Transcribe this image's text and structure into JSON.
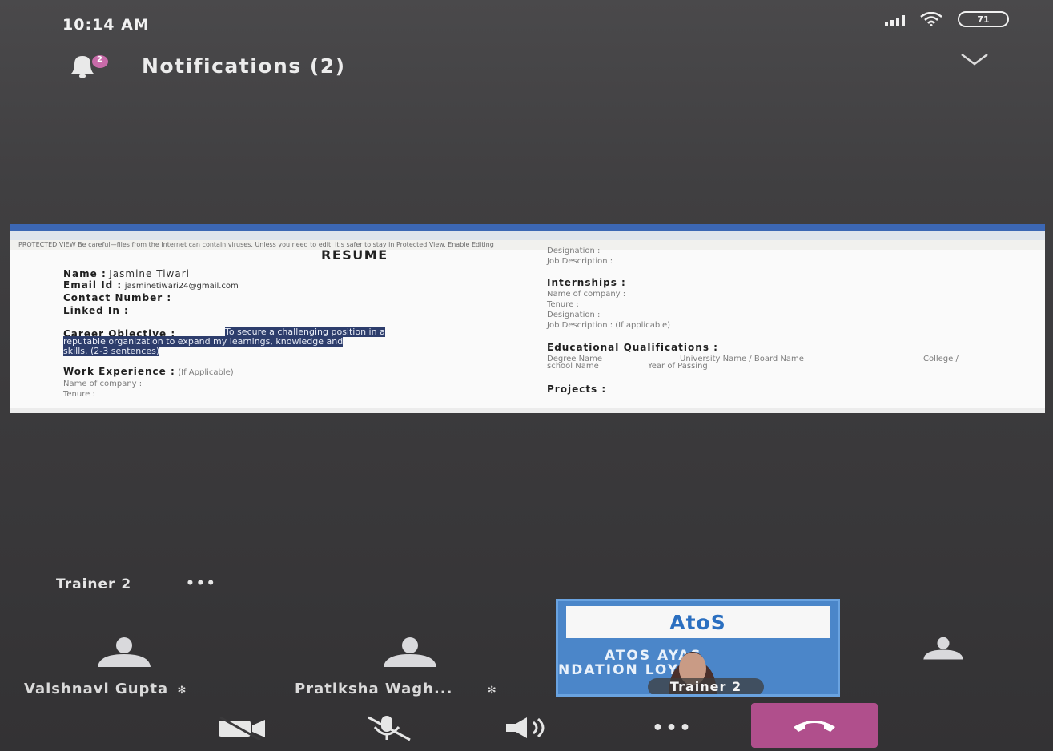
{
  "status_bar": {
    "time": "10:14 AM",
    "battery": "71"
  },
  "notifications": {
    "title": "Notifications (2)",
    "count": "2"
  },
  "shared_screen": {
    "infobar_text": "PROTECTED VIEW Be careful—files from the Internet can contain viruses. Unless you need to edit, it's safer to stay in Protected View.   Enable Editing",
    "resume": {
      "title": "RESUME",
      "name_label": "Name :",
      "name_value": "Jasmine Tiwari",
      "email_label": "Email Id :",
      "email_value": "jasminetiwari24@gmail.com",
      "contact_label": "Contact Number :",
      "linkedin_label": "Linked In :",
      "objective_label": "Career Objective :",
      "objective_line1": "To secure a challenging position in a",
      "objective_line2": "reputable organization to expand my learnings, knowledge and",
      "objective_line3": "skills. (2-3 sentences)",
      "work_label": "Work Experience :",
      "work_note": "(If Applicable)",
      "work_company": "Name of company :",
      "work_tenure": "Tenure :",
      "right_designation": "Designation :",
      "right_jobdesc": "Job Description :",
      "internships_label": "Internships :",
      "intern_company": "Name of company :",
      "intern_tenure": "Tenure :",
      "intern_designation": "Designation :",
      "intern_jobdesc": "Job Description : (If applicable)",
      "edu_label": "Educational Qualifications :",
      "edu_degree": "Degree Name",
      "edu_university": "University Name / Board Name",
      "edu_college": "College /",
      "edu_school": "school Name",
      "edu_year": "Year of Passing",
      "projects_label": "Projects :"
    }
  },
  "call": {
    "presenter_label": "Trainer 2",
    "more_label": "•••",
    "participants": [
      {
        "name": "Vaishnavi Gupta"
      },
      {
        "name": "Pratiksha Wagh..."
      }
    ],
    "video": {
      "logo": "AtoS",
      "line1": "ATOS    AYAS",
      "line2": "NDATION    LOYAB",
      "name_tag": "Trainer 2"
    }
  },
  "controls": {
    "more": "•••"
  },
  "colors": {
    "end_call": "#b04f8c",
    "word_ribbon": "#3c67b4",
    "video_bg": "#4b86c9"
  }
}
